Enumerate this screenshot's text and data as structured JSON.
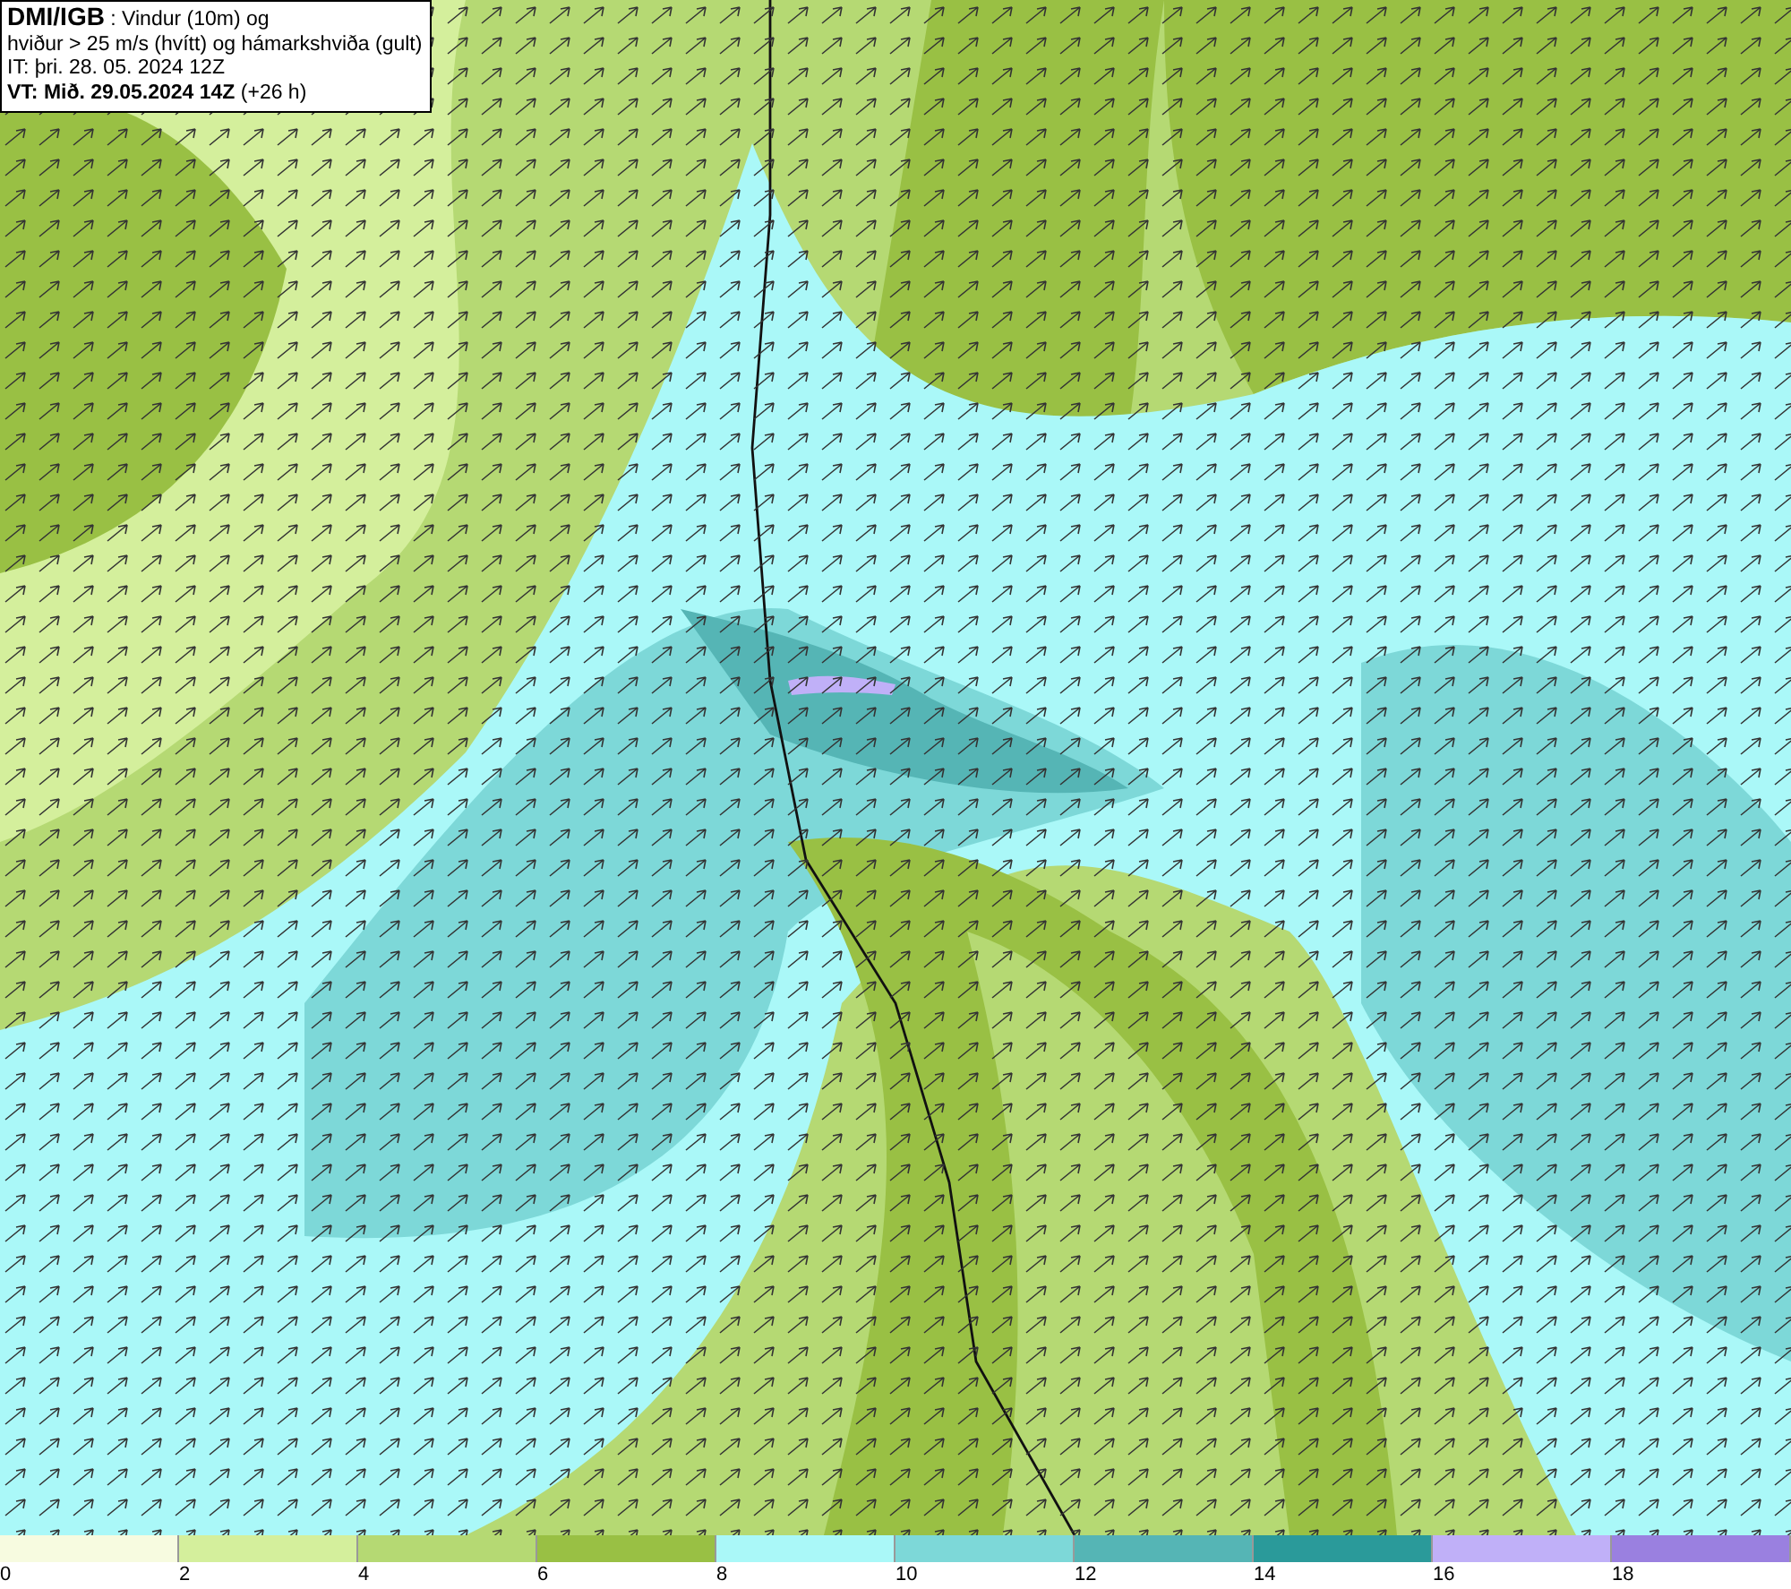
{
  "title_box": {
    "lines": [
      "**DMI/IGB** : Vindur (10m) og",
      "hviður > 25 m/s (hvítt) og hámarkshviða (gult)",
      "IT: þri. 28. 05. 2024 12Z",
      "**VT: Mið. 29.05.2024 14Z** (+26 h)"
    ]
  },
  "legend": [
    {
      "label": "0",
      "color": "#f7fbe0"
    },
    {
      "label": "2",
      "color": "#d4ef9c"
    },
    {
      "label": "4",
      "color": "#b5d973"
    },
    {
      "label": "6",
      "color": "#99c044"
    },
    {
      "label": "8",
      "color": "#aaf8f8"
    },
    {
      "label": "10",
      "color": "#7dd8d8"
    },
    {
      "label": "12",
      "color": "#55b5b5"
    },
    {
      "label": "14",
      "color": "#2a9a9a"
    },
    {
      "label": "16",
      "color": "#c0b0f8"
    },
    {
      "label": "18",
      "color": "#9a80e0"
    }
  ]
}
